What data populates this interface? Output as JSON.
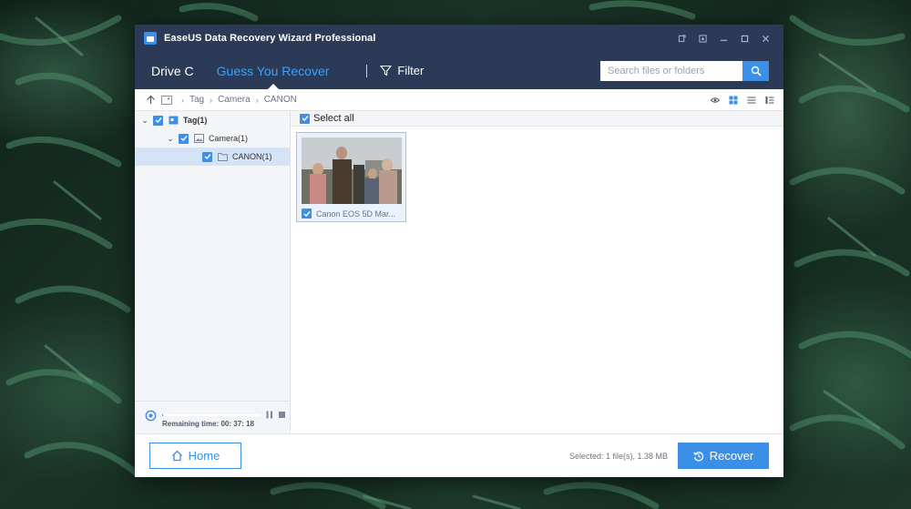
{
  "window": {
    "title": "EaseUS Data Recovery Wizard Professional"
  },
  "nav": {
    "tabs": [
      {
        "label": "Drive C",
        "active": false
      },
      {
        "label": "Guess You Recover",
        "active": true
      }
    ],
    "filter_label": "Filter",
    "search_placeholder": "Search files or folders"
  },
  "breadcrumb": {
    "items": [
      "Tag",
      "Camera",
      "CANON"
    ]
  },
  "view_modes": [
    "preview-eye-icon",
    "grid-view-icon",
    "list-view-icon",
    "detail-view-icon"
  ],
  "tree": {
    "items": [
      {
        "label": "Tag(1)",
        "level": 0,
        "expanded": true,
        "checked": true,
        "icon": "tag-icon"
      },
      {
        "label": "Camera(1)",
        "level": 1,
        "expanded": true,
        "checked": true,
        "icon": "image-icon"
      },
      {
        "label": "CANON(1)",
        "level": 2,
        "checked": true,
        "selected": true,
        "icon": "folder-icon"
      }
    ]
  },
  "progress": {
    "remaining_label": "Remaining time: 00: 37: 18",
    "fraction": 0.01
  },
  "files": {
    "select_all_label": "Select all",
    "items": [
      {
        "name": "Canon EOS 5D Mar...",
        "checked": true
      }
    ]
  },
  "footer": {
    "home_label": "Home",
    "selected_info": "Selected: 1 file(s), 1.38 MB",
    "recover_label": "Recover"
  },
  "colors": {
    "titlebar": "#2b3a56",
    "accent": "#3c8fe6",
    "active_tab": "#3fa0f7"
  }
}
